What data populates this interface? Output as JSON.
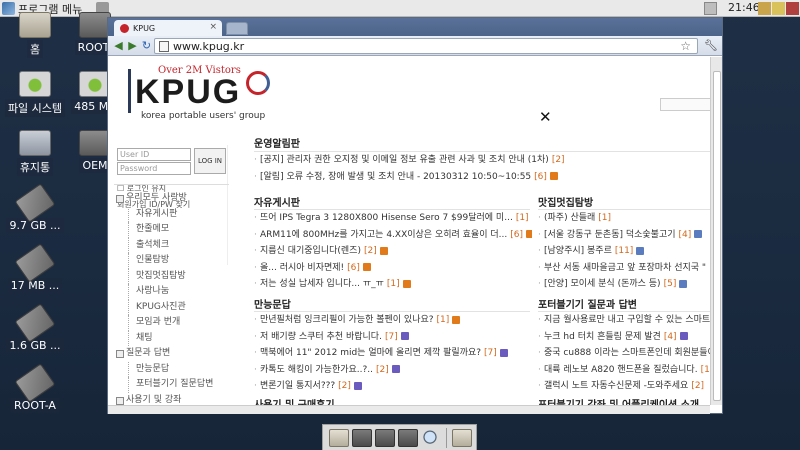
{
  "top_panel": {
    "menu_label": "프로그램 메뉴",
    "clock": "21:46"
  },
  "desktop": {
    "icons": [
      {
        "label": "홈",
        "glyph": "folder-icon"
      },
      {
        "label": "ROOT-",
        "glyph": "drive-icon"
      },
      {
        "label": "파일 시스템",
        "glyph": "drive-icon"
      },
      {
        "label": "485 MB",
        "glyph": "drive-icon"
      },
      {
        "label": "휴지통",
        "glyph": "trash-icon"
      },
      {
        "label": "OEM",
        "glyph": "drive-icon"
      },
      {
        "label": "9.7 GB ...",
        "glyph": "usb-drive-icon"
      },
      {
        "label": "17 MB ...",
        "glyph": "usb-drive-icon"
      },
      {
        "label": "1.6 GB ...",
        "glyph": "usb-drive-icon"
      },
      {
        "label": "ROOT-A",
        "glyph": "usb-drive-icon"
      }
    ]
  },
  "browser": {
    "tab_title": "KPUG",
    "url": "www.kpug.kr"
  },
  "site": {
    "logo_tagline": "Over 2M Vistors",
    "logo_text": "KPUG",
    "logo_sub": "korea portable users' group",
    "close_glyph": "✕",
    "login": {
      "id_placeholder": "User ID",
      "pw_placeholder": "Password",
      "button": "LOG IN",
      "keep": "로그인 유지",
      "join": "회원가입",
      "find": "ID/PW 찾기"
    },
    "menu": [
      {
        "label": "우리모두 사랑방",
        "level": 0
      },
      {
        "label": "자유게시판",
        "level": 1
      },
      {
        "label": "한줄메모",
        "level": 1
      },
      {
        "label": "출석체크",
        "level": 1
      },
      {
        "label": "인물탐방",
        "level": 1
      },
      {
        "label": "맛집멋집탐방",
        "level": 1
      },
      {
        "label": "사랑나눔",
        "level": 1
      },
      {
        "label": "KPUG사진관",
        "level": 1
      },
      {
        "label": "모임과 번개",
        "level": 1
      },
      {
        "label": "채팅",
        "level": 1
      },
      {
        "label": "질문과 답변",
        "level": 0
      },
      {
        "label": "만능문답",
        "level": 1
      },
      {
        "label": "포터블기기 질문답변",
        "level": 1
      },
      {
        "label": "사용기 및 강좌",
        "level": 0
      }
    ],
    "notice": {
      "title": "운영알림판",
      "posts": [
        {
          "text": "[공지] 관리자 권한 오지정 및 이메일 정보 유출 관련 사과 및 조치 안내 (1차)",
          "count": "[2]"
        },
        {
          "text": "[알림] 오류 수정, 장애 발생 및 조치 안내 - 20130312 10:50~10:55",
          "count": "[6]",
          "badge": "new"
        }
      ]
    },
    "free_board": {
      "title": "자유게시판",
      "posts": [
        {
          "text": "뜨어 IPS Tegra 3 1280X800 Hisense Sero 7 $99달러에 미...",
          "count": "[1]",
          "badge": "new"
        },
        {
          "text": "ARM11에 800MHz를 가지고는 4.XX이상은 오히려 효율이 더...",
          "count": "[6]",
          "badge": "new"
        },
        {
          "text": "지름신 대기중입니다(렌즈)",
          "count": "[2]",
          "badge": "new"
        },
        {
          "text": "올... 러시아 비자면제!",
          "count": "[6]",
          "badge": "new"
        },
        {
          "text": "저는 성실 납세자 입니다... ㅠ_ㅠ",
          "count": "[1]",
          "badge": "new"
        }
      ]
    },
    "food_board": {
      "title": "맛집멋집탐방",
      "posts": [
        {
          "text": "(파주) 산들래",
          "count": "[1]"
        },
        {
          "text": "[서울 강동구 둔촌동] 덕소숯불고기",
          "count": "[4]",
          "badge": "img"
        },
        {
          "text": "[남양주시] 봉주르",
          "count": "[11]",
          "badge": "img"
        },
        {
          "text": "부산 서동 새마을금고 앞 포장마차 선지국 \"",
          "count": ""
        },
        {
          "text": "[안양] 모이세 분식 (돈까스 등)",
          "count": "[5]",
          "badge": "img"
        }
      ]
    },
    "qa_board": {
      "title": "만능문답",
      "posts": [
        {
          "text": "만년필처럼 잉크리필이 가능한 볼펜이 있나요?",
          "count": "[1]",
          "badge": "new"
        },
        {
          "text": "저 배기량 스쿠터 추천 바랍니다.",
          "count": "[7]",
          "badge": "upd"
        },
        {
          "text": "맥북에어 11\" 2012 mid는 얼마에 올리면 제깍 팔릴까요?",
          "count": "[7]",
          "badge": "upd"
        },
        {
          "text": "카톡도 해킹이 가능한가요..?..",
          "count": "[2]",
          "badge": "upd"
        },
        {
          "text": "변론기일 통지서???",
          "count": "[2]",
          "badge": "upd"
        }
      ]
    },
    "portable_qa": {
      "title": "포터블기기 질문과 답변",
      "posts": [
        {
          "text": "지금 월사용료만 내고 구입할 수 있는 스마트",
          "count": ""
        },
        {
          "text": "누크 hd 터치 흔들림 문제 발견",
          "count": "[4]",
          "badge": "upd"
        },
        {
          "text": "중국 cu888 이라는 스마트폰인데 회원분들이",
          "count": ""
        },
        {
          "text": "대륙 레노보 A820 핸드폰을 질렀습니다.",
          "count": "[1"
        },
        {
          "text": "갤럭시 노트 자동수신문제 -도와주세요",
          "count": "[2]"
        }
      ]
    },
    "reviews_title": "사용기 및 구매후기",
    "lectures_title": "포터블기기 강좌 및 어플리케이션 소개"
  },
  "colors": {
    "accent_red": "#c6242b",
    "count_orange": "#d2691e",
    "badge_new": "#e07a1b",
    "badge_update": "#6b5bbf"
  }
}
